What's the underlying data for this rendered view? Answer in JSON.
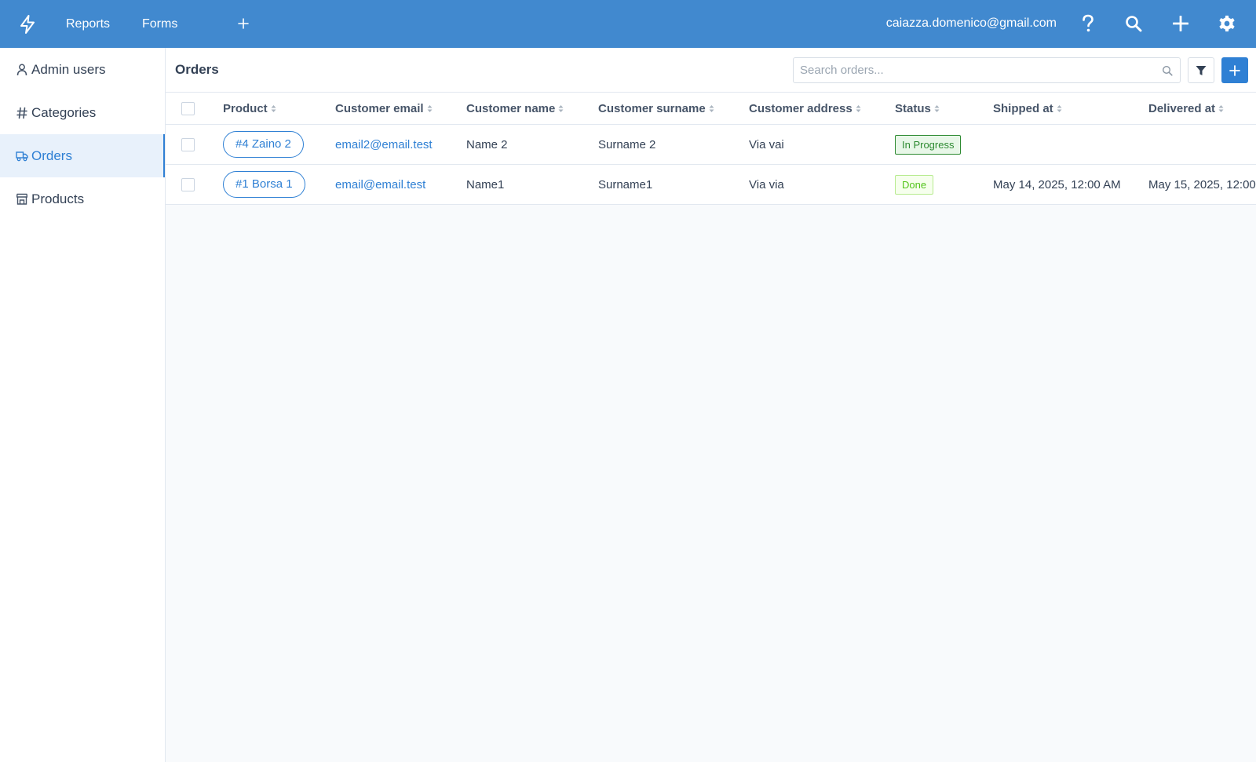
{
  "topbar": {
    "nav": [
      "Reports",
      "Forms"
    ],
    "user_email": "caiazza.domenico@gmail.com",
    "icons": [
      "bolt-logo-icon",
      "plus-icon",
      "help-icon",
      "search-icon",
      "plus-icon",
      "gear-icon"
    ]
  },
  "sidebar": {
    "items": [
      {
        "label": "Admin users",
        "icon": "user-icon"
      },
      {
        "label": "Categories",
        "icon": "hash-icon"
      },
      {
        "label": "Orders",
        "icon": "truck-icon",
        "active": true
      },
      {
        "label": "Products",
        "icon": "store-icon"
      }
    ]
  },
  "main": {
    "title": "Orders",
    "search_placeholder": "Search orders...",
    "icons": [
      "filter-icon",
      "plus-icon"
    ]
  },
  "table": {
    "columns": [
      "Product",
      "Customer email",
      "Customer name",
      "Customer surname",
      "Customer address",
      "Status",
      "Shipped at",
      "Delivered at"
    ],
    "rows": [
      {
        "product": "#4 Zaino 2",
        "email": "email2@email.test",
        "name": "Name 2",
        "surname": "Surname 2",
        "address": "Via vai",
        "status": "In Progress",
        "shipped_at": "",
        "delivered_at": ""
      },
      {
        "product": "#1 Borsa 1",
        "email": "email@email.test",
        "name": "Name1",
        "surname": "Surname1",
        "address": "Via via",
        "status": "Done",
        "shipped_at": "May 14, 2025, 12:00 AM",
        "delivered_at": "May 15, 2025, 12:00"
      }
    ]
  },
  "colors": {
    "topbar_bg": "#4189cf",
    "accent": "#2f80d4",
    "status_in_progress": "#2d8a31",
    "status_done": "#52c41a"
  }
}
